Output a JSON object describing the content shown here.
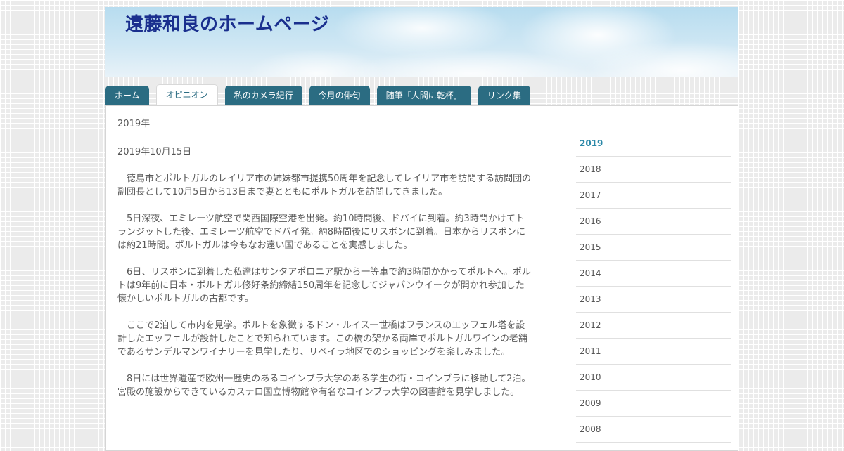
{
  "site": {
    "title": "遠藤和良のホームページ"
  },
  "nav": {
    "tabs": [
      {
        "label": "ホーム"
      },
      {
        "label": "オピニオン"
      },
      {
        "label": "私のカメラ紀行"
      },
      {
        "label": "今月の俳句"
      },
      {
        "label": "随筆「人間に乾杯」"
      },
      {
        "label": "リンク集"
      }
    ],
    "active_index": 1
  },
  "main": {
    "year_heading": "2019年",
    "post_date": "2019年10月15日",
    "paragraphs": [
      "徳島市とポルトガルのレイリア市の姉妹都市提携50周年を記念してレイリア市を訪問する訪問団の副団長として10月5日から13日まで妻とともにポルトガルを訪問してきました。",
      "5日深夜、エミレーツ航空で関西国際空港を出発。約10時間後、ドバイに到着。約3時間かけてトランジットした後、エミレーツ航空でドバイ発。約8時間後にリスボンに到着。日本からリスボンには約21時間。ポルトガルは今もなお遠い国であることを実感しました。",
      "6日、リスボンに到着した私達はサンタアポロニア駅から一等車で約3時間かかってポルトへ。ポルトは9年前に日本・ポルトガル修好条約締結150周年を記念してジャパンウイークが開かれ参加した懐かしいポルトガルの古都です。",
      "ここで2泊して市内を見学。ポルトを象徴するドン・ルイス一世橋はフランスのエッフェル塔を設計したエッフェルが設計したことで知られています。この橋の架かる両岸でポルトガルワインの老舗であるサンデルマンワイナリーを見学したり、リベイラ地区でのショッピングを楽しみました。",
      "8日には世界遺産で欧州一歴史のあるコインブラ大学のある学生の街・コインブラに移動して2泊。宮殿の施設からできているカステロ国立博物館や有名なコインブラ大学の図書館を見学しました。"
    ]
  },
  "sidebar": {
    "years": [
      "2019",
      "2018",
      "2017",
      "2016",
      "2015",
      "2014",
      "2013",
      "2012",
      "2011",
      "2010",
      "2009",
      "2008"
    ],
    "active_year": "2019"
  },
  "colors": {
    "title": "#1a2f8e",
    "tab_bg": "#2b6c82",
    "active_link": "#2b88a8"
  }
}
